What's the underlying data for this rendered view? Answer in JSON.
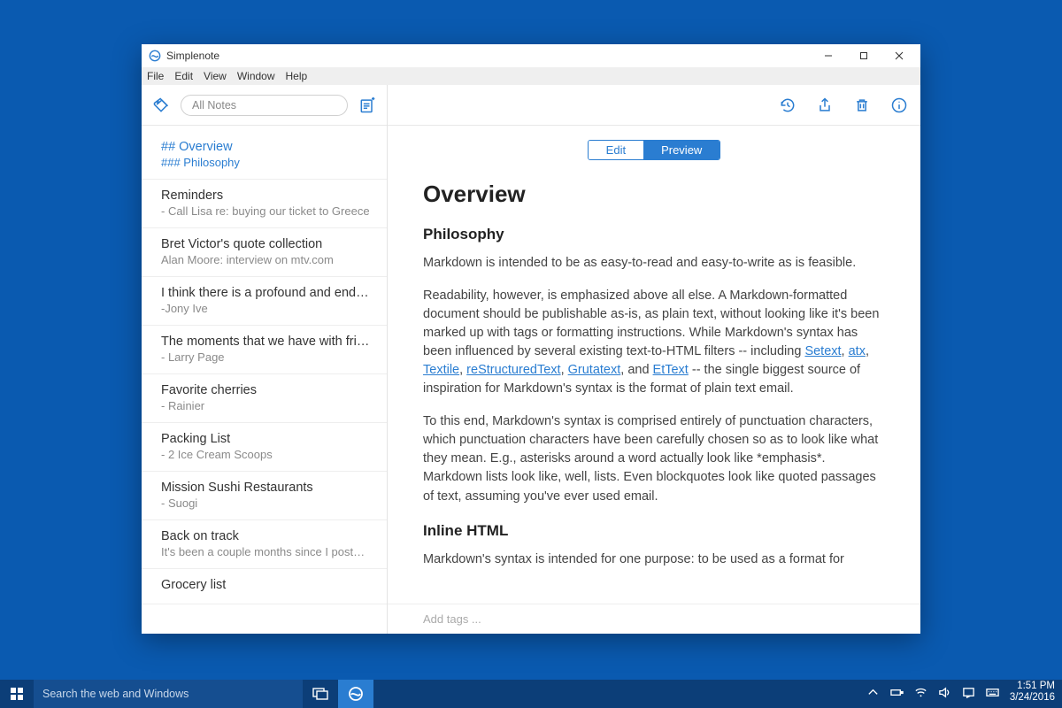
{
  "window": {
    "title": "Simplenote"
  },
  "menu": {
    "file": "File",
    "edit": "Edit",
    "view": "View",
    "window": "Window",
    "help": "Help"
  },
  "sidebar": {
    "search_placeholder": "All Notes",
    "notes": [
      {
        "title": "## Overview",
        "subtitle": "### Philosophy",
        "selected": true
      },
      {
        "title": "Reminders",
        "subtitle": "- Call Lisa re: buying our ticket to Greece"
      },
      {
        "title": "Bret Victor's quote collection",
        "subtitle": "Alan Moore: interview on mtv.com"
      },
      {
        "title": "I think there is a profound and enduri...",
        "subtitle": "-Jony Ive"
      },
      {
        "title": "The moments that we have with friend...",
        "subtitle": "- Larry Page"
      },
      {
        "title": "Favorite cherries",
        "subtitle": "- Rainier"
      },
      {
        "title": "Packing List",
        "subtitle": "- 2 Ice Cream Scoops"
      },
      {
        "title": "Mission Sushi Restaurants",
        "subtitle": "- Suogi"
      },
      {
        "title": "Back on track",
        "subtitle": "It's been a couple months since I posted on ..."
      },
      {
        "title": "Grocery list",
        "subtitle": ""
      }
    ]
  },
  "segmented": {
    "edit": "Edit",
    "preview": "Preview"
  },
  "document": {
    "h2": "Overview",
    "h3a": "Philosophy",
    "p1": "Markdown is intended to be as easy-to-read and easy-to-write as is feasible.",
    "p2a": "Readability, however, is emphasized above all else. A Markdown-formatted document should be publishable as-is, as plain text, without looking like it's been marked up with tags or formatting instructions. While Markdown's syntax has been influenced by several existing text-to-HTML filters -- including ",
    "link_setext": "Setext",
    "sep1": ", ",
    "link_atx": "atx",
    "sep2": ", ",
    "link_textile": "Textile",
    "sep3": ", ",
    "link_rst": "reStructuredText",
    "sep4": ", ",
    "link_grutatext": "Grutatext",
    "sep5": ", and ",
    "link_ettext": "EtText",
    "p2b": " -- the single biggest source of inspiration for Markdown's syntax is the format of plain text email.",
    "p3": "To this end, Markdown's syntax is comprised entirely of punctuation characters, which punctuation characters have been carefully chosen so as to look like what they mean. E.g., asterisks around a word actually look like *emphasis*. Markdown lists look like, well, lists. Even blockquotes look like quoted passages of text, assuming you've ever used email.",
    "h3b": "Inline HTML",
    "p4": "Markdown's syntax is intended for one purpose: to be used as a format for"
  },
  "tags_placeholder": "Add tags ...",
  "taskbar": {
    "search_placeholder": "Search the web and Windows",
    "time": "1:51 PM",
    "date": "3/24/2016"
  }
}
